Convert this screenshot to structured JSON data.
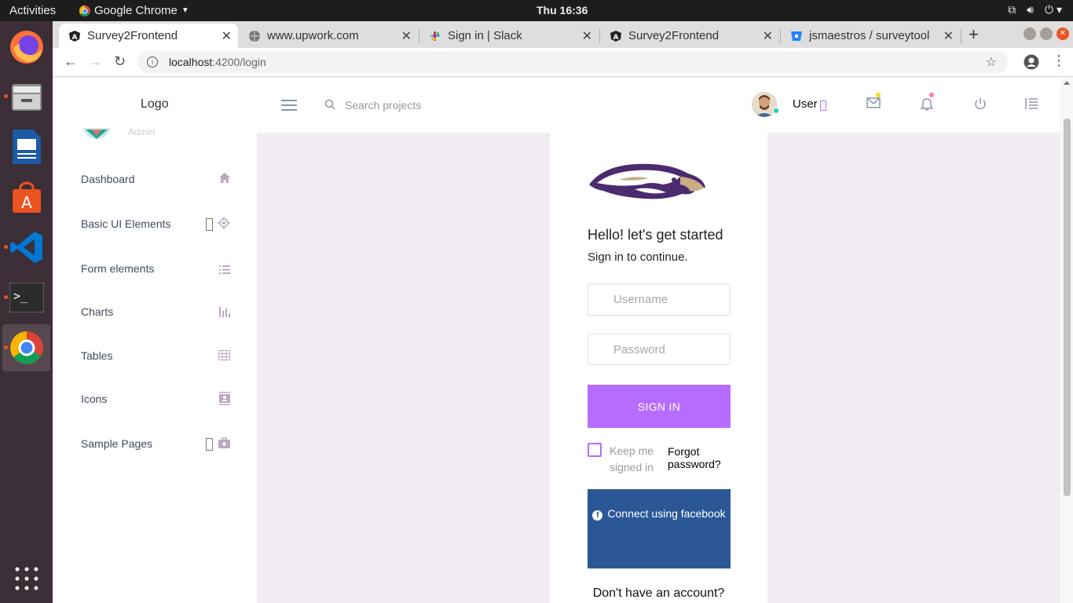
{
  "system": {
    "activities": "Activities",
    "app_name": "Google Chrome",
    "clock": "Thu 16:36"
  },
  "browser": {
    "tabs": [
      {
        "title": "Survey2Frontend",
        "favicon": "A"
      },
      {
        "title": "www.upwork.com",
        "favicon": "globe"
      },
      {
        "title": "Sign in | Slack",
        "favicon": "slack"
      },
      {
        "title": "Survey2Frontend",
        "favicon": "A"
      },
      {
        "title": "jsmaestros / surveytool",
        "favicon": "bitbucket"
      }
    ],
    "new_tab": "+",
    "url_host": "localhost",
    "url_rest": ":4200/login"
  },
  "navbar": {
    "logo": "Logo",
    "search_placeholder": "Search projects",
    "user": "User"
  },
  "sidebar": {
    "role": "Admin",
    "items": [
      {
        "label": "Dashboard",
        "icon": "home-icon"
      },
      {
        "label": "Basic UI Elements",
        "icon": "crosshairs-icon"
      },
      {
        "label": "Form elements",
        "icon": "list-icon"
      },
      {
        "label": "Charts",
        "icon": "bar-chart-icon"
      },
      {
        "label": "Tables",
        "icon": "table-icon"
      },
      {
        "label": "Icons",
        "icon": "contacts-icon"
      },
      {
        "label": "Sample Pages",
        "icon": "medical-bag-icon"
      }
    ]
  },
  "login": {
    "greeting": "Hello! let's get started",
    "subtitle": "Sign in to continue.",
    "username_placeholder": "Username",
    "password_placeholder": "Password",
    "signin": "SIGN IN",
    "keep_signed_in": "Keep me signed in",
    "forgot": "Forgot password?",
    "facebook": "Connect using facebook",
    "no_account": "Don't have an account?"
  },
  "colors": {
    "accent": "#b66dff",
    "facebook": "#2b5797",
    "page_bg": "#f2edf3"
  }
}
